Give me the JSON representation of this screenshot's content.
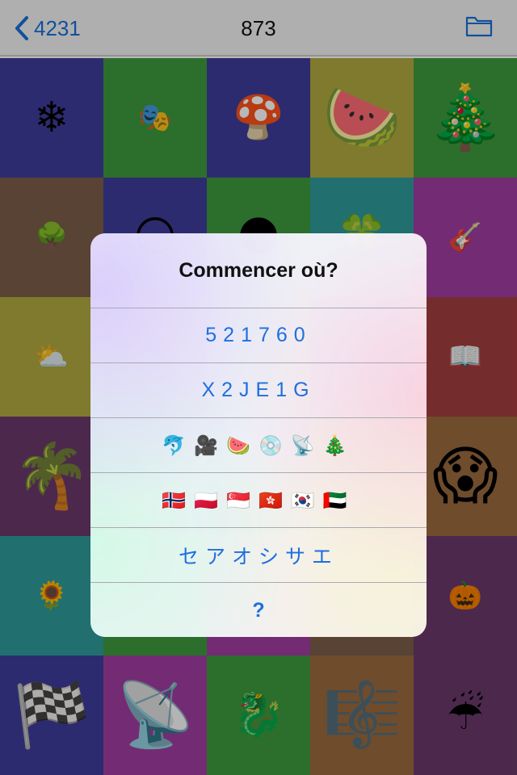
{
  "navbar": {
    "back_label": "4231",
    "title": "873"
  },
  "grid": [
    {
      "bg": "#3f3c9a",
      "emoji": "❄",
      "size": "m"
    },
    {
      "bg": "#3d9a3d",
      "emoji": "🎭",
      "size": "s"
    },
    {
      "bg": "#3f3c9a",
      "emoji": "🍄",
      "size": "m"
    },
    {
      "bg": "#b0aa3f",
      "emoji": "🍉",
      "size": "l"
    },
    {
      "bg": "#3d9a3d",
      "emoji": "🎄",
      "size": "l"
    },
    {
      "bg": "#7a5e4a",
      "emoji": "🌳",
      "size": "s"
    },
    {
      "bg": "#3f3c9a",
      "emoji": "🌕",
      "size": "m"
    },
    {
      "bg": "#3d9a3d",
      "emoji": "🌑",
      "size": "m"
    },
    {
      "bg": "#2e9a9a",
      "emoji": "🍀",
      "size": "m"
    },
    {
      "bg": "#a03ea0",
      "emoji": "🎸",
      "size": "s"
    },
    {
      "bg": "#b0aa3f",
      "emoji": "⛅",
      "size": "s"
    },
    {
      "bg": "#7a5e4a",
      "emoji": "",
      "size": "m"
    },
    {
      "bg": "#3d9a3d",
      "emoji": "",
      "size": "m"
    },
    {
      "bg": "#3f3c9a",
      "emoji": "",
      "size": "m"
    },
    {
      "bg": "#a33d3d",
      "emoji": "📖",
      "size": "s"
    },
    {
      "bg": "#6a3a6a",
      "emoji": "🌴",
      "size": "l"
    },
    {
      "bg": "#a03ea0",
      "emoji": "",
      "size": "m"
    },
    {
      "bg": "#3f3c9a",
      "emoji": "",
      "size": "m"
    },
    {
      "bg": "#3d9a3d",
      "emoji": "",
      "size": "m"
    },
    {
      "bg": "#9a6a3d",
      "emoji": "😱",
      "size": "l"
    },
    {
      "bg": "#2e9a9a",
      "emoji": "🌻",
      "size": "s"
    },
    {
      "bg": "#3d9a3d",
      "emoji": "",
      "size": "m"
    },
    {
      "bg": "#a03ea0",
      "emoji": "",
      "size": "m"
    },
    {
      "bg": "#7a5e4a",
      "emoji": "",
      "size": "m"
    },
    {
      "bg": "#6a3a6a",
      "emoji": "🎃",
      "size": "s"
    },
    {
      "bg": "#3f3c9a",
      "emoji": "🏁",
      "size": "l"
    },
    {
      "bg": "#a03ea0",
      "emoji": "📡",
      "size": "l"
    },
    {
      "bg": "#3d9a3d",
      "emoji": "🐉",
      "size": "m"
    },
    {
      "bg": "#9a6a3d",
      "emoji": "🎼",
      "size": "l"
    },
    {
      "bg": "#6a3a6a",
      "emoji": "☔",
      "size": "m"
    }
  ],
  "dialog": {
    "title": "Commencer où?",
    "options": [
      "521760",
      "X2JE1G",
      "🐬🎥🍉💿📡🎄",
      "🇳🇴🇵🇱🇸🇬🇭🇰🇰🇷🇦🇪",
      "セアオシサエ",
      "?"
    ]
  },
  "colors": {
    "accent": "#1e6fe0"
  }
}
